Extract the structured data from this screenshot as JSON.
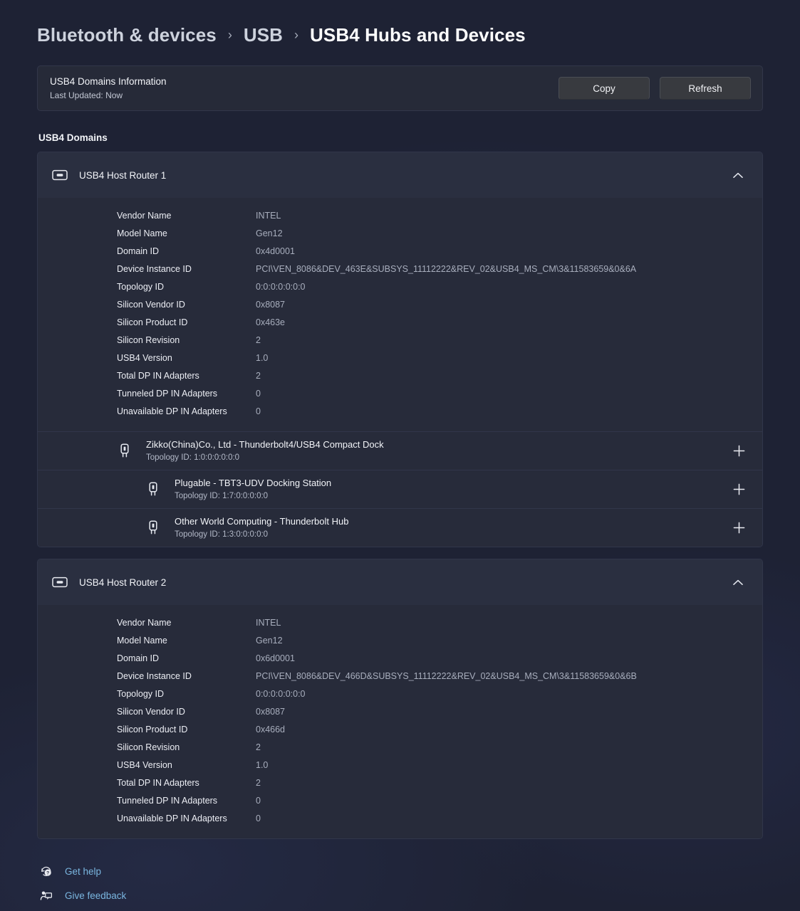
{
  "breadcrumb": {
    "items": [
      {
        "label": "Bluetooth & devices",
        "current": false
      },
      {
        "label": "USB",
        "current": false
      },
      {
        "label": "USB4 Hubs and Devices",
        "current": true
      }
    ],
    "separator": "›"
  },
  "info_card": {
    "title": "USB4 Domains Information",
    "updated_label": "Last Updated:",
    "updated_value": "Now",
    "copy_label": "Copy",
    "refresh_label": "Refresh"
  },
  "section": {
    "title": "USB4 Domains"
  },
  "routers": [
    {
      "name": "USB4 Host Router 1",
      "expanded": true,
      "properties": [
        {
          "key": "Vendor Name",
          "value": "INTEL"
        },
        {
          "key": "Model Name",
          "value": "Gen12"
        },
        {
          "key": "Domain ID",
          "value": "0x4d0001"
        },
        {
          "key": "Device Instance ID",
          "value": "PCI\\VEN_8086&DEV_463E&SUBSYS_11112222&REV_02&USB4_MS_CM\\3&11583659&0&6A"
        },
        {
          "key": "Topology ID",
          "value": "0:0:0:0:0:0:0"
        },
        {
          "key": "Silicon Vendor ID",
          "value": "0x8087"
        },
        {
          "key": "Silicon Product ID",
          "value": "0x463e"
        },
        {
          "key": "Silicon Revision",
          "value": "2"
        },
        {
          "key": "USB4 Version",
          "value": "1.0"
        },
        {
          "key": "Total DP IN Adapters",
          "value": "2"
        },
        {
          "key": "Tunneled DP IN Adapters",
          "value": "0"
        },
        {
          "key": "Unavailable DP IN Adapters",
          "value": "0"
        }
      ],
      "devices": [
        {
          "name": "Zikko(China)Co., Ltd - Thunderbolt4/USB4 Compact Dock",
          "topology_label": "Topology ID:",
          "topology_value": "1:0:0:0:0:0:0",
          "depth": 0
        },
        {
          "name": "Plugable - TBT3-UDV Docking Station",
          "topology_label": "Topology ID:",
          "topology_value": "1:7:0:0:0:0:0",
          "depth": 1
        },
        {
          "name": "Other World Computing - Thunderbolt Hub",
          "topology_label": "Topology ID:",
          "topology_value": "1:3:0:0:0:0:0",
          "depth": 1
        }
      ]
    },
    {
      "name": "USB4 Host Router 2",
      "expanded": true,
      "properties": [
        {
          "key": "Vendor Name",
          "value": "INTEL"
        },
        {
          "key": "Model Name",
          "value": "Gen12"
        },
        {
          "key": "Domain ID",
          "value": "0x6d0001"
        },
        {
          "key": "Device Instance ID",
          "value": "PCI\\VEN_8086&DEV_466D&SUBSYS_11112222&REV_02&USB4_MS_CM\\3&11583659&0&6B"
        },
        {
          "key": "Topology ID",
          "value": "0:0:0:0:0:0:0"
        },
        {
          "key": "Silicon Vendor ID",
          "value": "0x8087"
        },
        {
          "key": "Silicon Product ID",
          "value": "0x466d"
        },
        {
          "key": "Silicon Revision",
          "value": "2"
        },
        {
          "key": "USB4 Version",
          "value": "1.0"
        },
        {
          "key": "Total DP IN Adapters",
          "value": "2"
        },
        {
          "key": "Tunneled DP IN Adapters",
          "value": "0"
        },
        {
          "key": "Unavailable DP IN Adapters",
          "value": "0"
        }
      ],
      "devices": []
    }
  ],
  "footer": {
    "links": [
      {
        "label": "Get help",
        "icon": "help-icon"
      },
      {
        "label": "Give feedback",
        "icon": "feedback-icon"
      }
    ]
  },
  "colors": {
    "page_background": "#1e2234",
    "card_background": "#272b3a",
    "header_background": "#2a2f40",
    "button_background": "#383a3f",
    "link_accent": "#7ab6e0",
    "primary_text": "#f2f4f8",
    "secondary_text": "#a8aebd"
  },
  "icons": {
    "router": "usb-port-icon",
    "device": "usb-plug-icon",
    "expanded": "chevron-up-icon",
    "collapsed": "plus-icon"
  }
}
